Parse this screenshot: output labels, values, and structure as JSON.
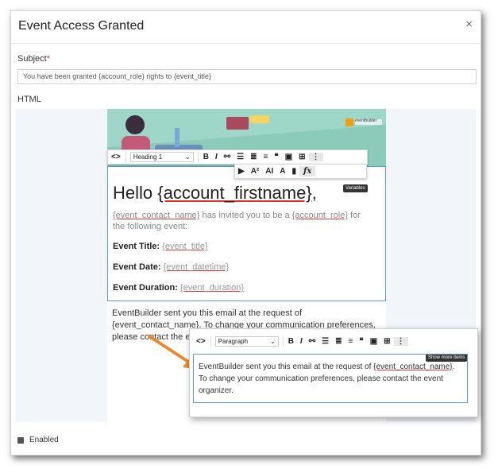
{
  "dialog": {
    "title": "Event Access Granted",
    "close": "×"
  },
  "subject": {
    "label": "Subject",
    "required_mark": "*",
    "value": "You have been granted {account_role} rights to {event_title}"
  },
  "html_label": "HTML",
  "banner": {
    "brand": "eventbuilder"
  },
  "toolbar_top": {
    "code": "<>",
    "style": "Heading 1",
    "bold": "B",
    "italic": "I",
    "quote": "❝",
    "more": "⋮"
  },
  "toolbar_second": {
    "variables_fx": "fx",
    "tooltip": "Variables"
  },
  "content": {
    "hello_prefix": "Hello ",
    "hello_var": "{account_firstname}",
    "hello_suffix": ",",
    "invite_var1": "{event_contact_name}",
    "invite_mid": " has invited you to be a ",
    "invite_var2": "{account_role}",
    "invite_end": " for the following event:",
    "event_title_label": "Event Title:",
    "event_title_value": "{event_title}",
    "event_date_label": "Event Date:",
    "event_date_value": "{event_datetime}",
    "event_duration_label": "Event Duration:",
    "event_duration_value": "{event_duration}"
  },
  "footer_text": "EventBuilder sent you this email at the request of {event_contact_name}. To change your communication preferences, please contact the event organizer.",
  "overlay": {
    "code": "<>",
    "style": "Paragraph",
    "bold": "B",
    "italic": "I",
    "quote": "❝",
    "more": "⋮",
    "tooltip": "Show more items",
    "text_prefix": "EventBuilder sent you this email at the request of ",
    "text_var": "{event_contact_name}",
    "text_suffix": ". To change your communication preferences, please contact the event organizer."
  },
  "enabled_label": "Enabled",
  "colors": {
    "accent_arrow": "#e8892b",
    "editor_border": "#5b9bd5",
    "required": "#e03131"
  }
}
